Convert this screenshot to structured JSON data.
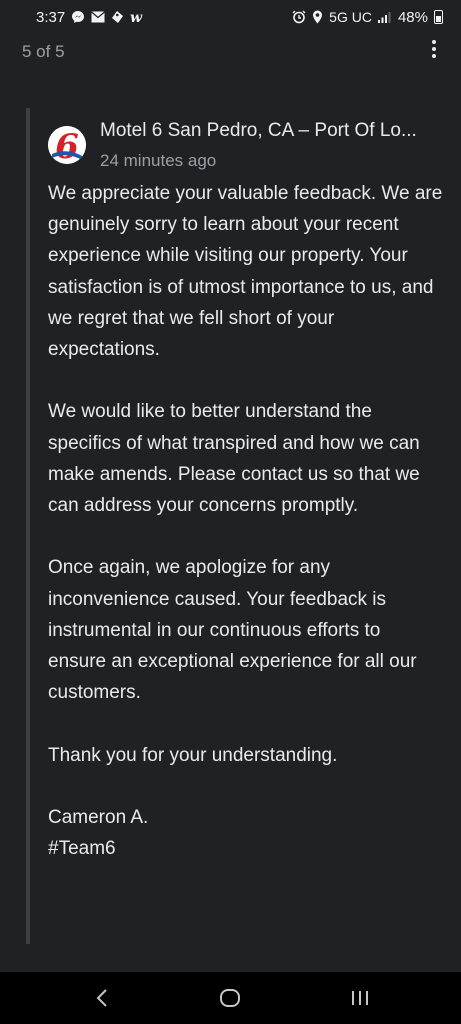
{
  "status_bar": {
    "time": "3:37",
    "network": "5G UC",
    "battery": "48%",
    "left_icons": [
      "messenger-icon",
      "mail-icon",
      "tag-icon",
      "walmart-w-icon"
    ],
    "right_icons": [
      "alarm-icon",
      "location-icon",
      "signal-icon",
      "battery-icon"
    ]
  },
  "header": {
    "counter": "5 of 5"
  },
  "reply": {
    "owner_name": "Motel 6 San Pedro, CA – Port Of Lo...",
    "time_ago": "24 minutes ago",
    "paragraphs": [
      "We appreciate your valuable feedback. We are genuinely sorry to learn about your recent experience while visiting our property. Your satisfaction is of utmost importance to us, and we regret that we fell short of your expectations.",
      "We would like to better understand the specifics of what transpired and how we can make amends. Please contact us so that we can address your concerns promptly.",
      "Once again, we apologize for any inconvenience caused. Your feedback is instrumental in our continuous efforts to ensure an exceptional experience for all our customers.",
      "Thank you for your understanding."
    ],
    "signature": "Cameron A.",
    "hashtag": "#Team6",
    "logo_text": "6",
    "logo_colors": {
      "red": "#d6202a",
      "blue": "#1f56a6"
    }
  },
  "nav": {
    "back": "back-icon",
    "home": "home-icon",
    "recents": "recents-icon"
  }
}
